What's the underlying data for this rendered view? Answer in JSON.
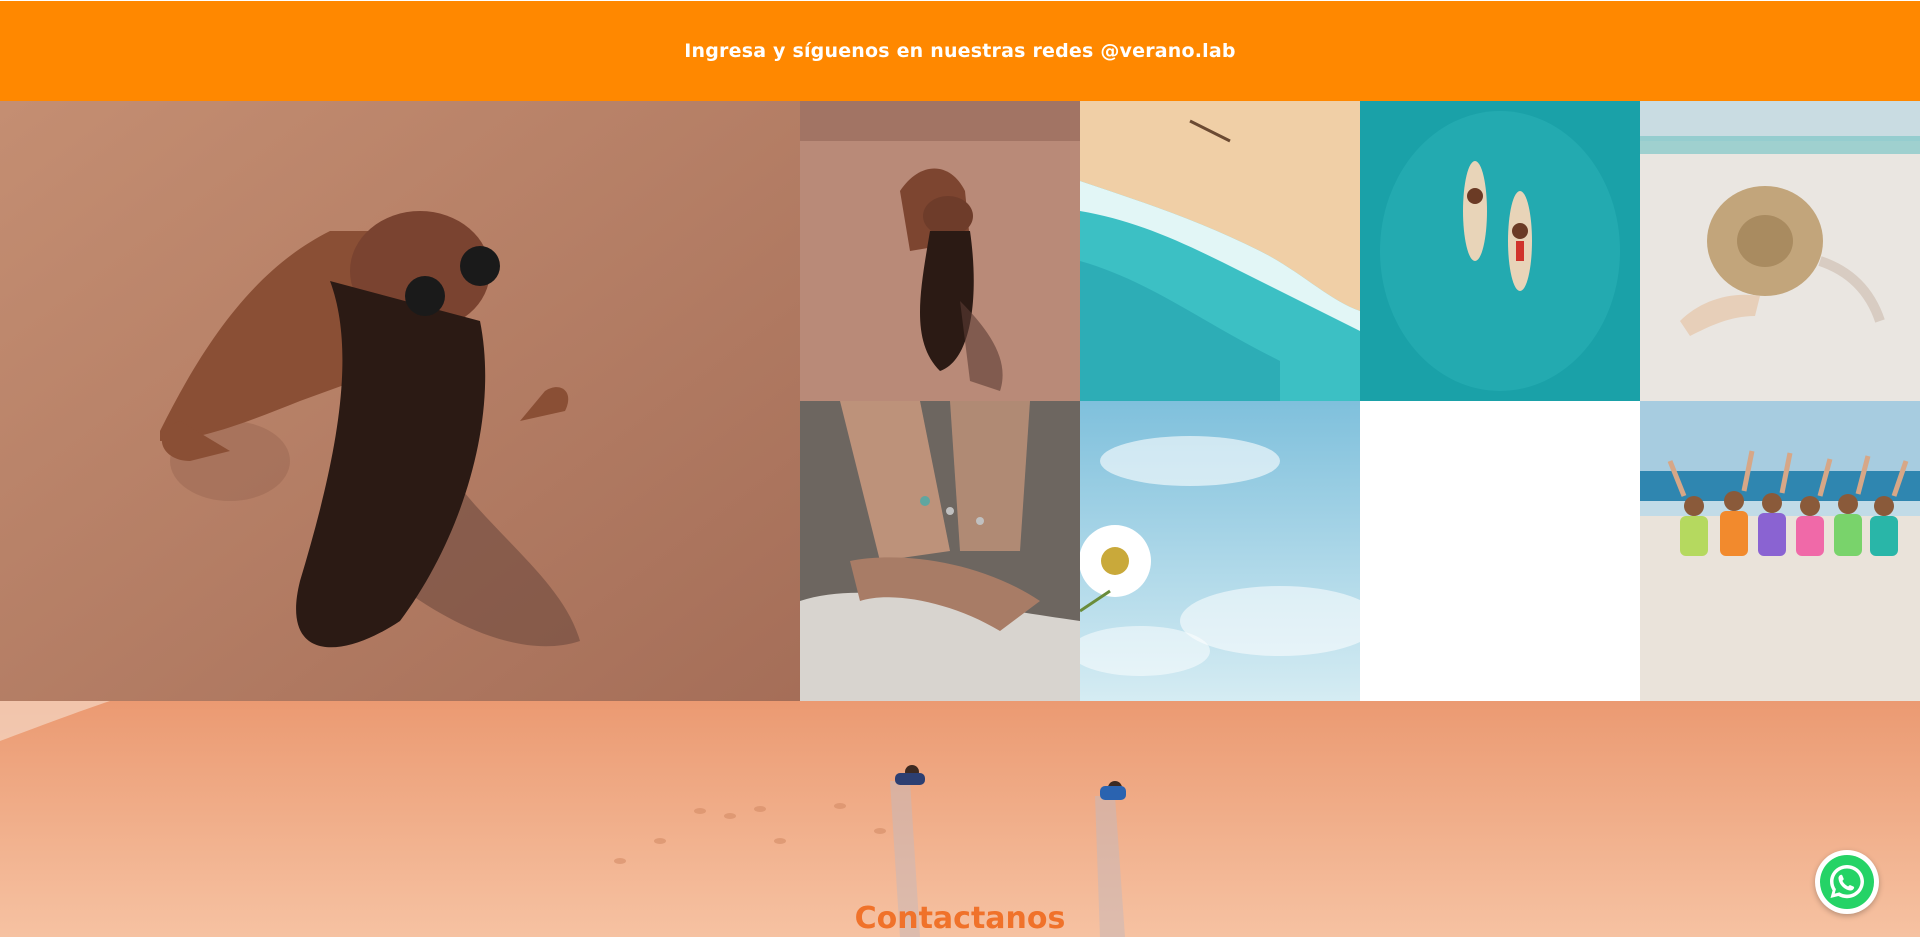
{
  "banner": {
    "text": "Ingresa y síguenos en nuestras redes @verano.lab",
    "background": "#ff8800"
  },
  "gallery": {
    "tiles": [
      {
        "name": "woman-on-sand-large"
      },
      {
        "name": "woman-on-sand-small"
      },
      {
        "name": "aerial-wave-shore"
      },
      {
        "name": "surfers-turquoise-water"
      },
      {
        "name": "woman-straw-hat"
      },
      {
        "name": "hands-rings-rock"
      },
      {
        "name": "daisy-sky"
      },
      {
        "name": "empty-tile"
      },
      {
        "name": "friends-swimsuits-beach"
      }
    ]
  },
  "contact": {
    "heading": "Contactanos",
    "heading_color": "#f0722a"
  },
  "whatsapp": {
    "icon": "whatsapp-icon",
    "color": "#25d366"
  }
}
